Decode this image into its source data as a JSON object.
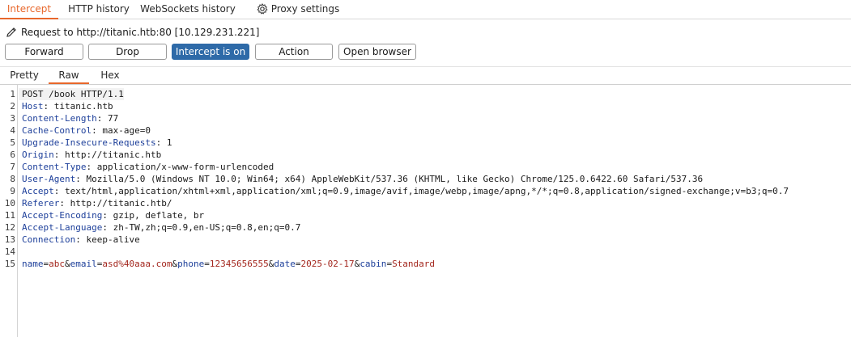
{
  "top_tabs": {
    "intercept": "Intercept",
    "http_history": "HTTP history",
    "websockets_history": "WebSockets history",
    "proxy_settings": "Proxy settings"
  },
  "request_info": "Request to http://titanic.htb:80  [10.129.231.221]",
  "buttons": {
    "forward": "Forward",
    "drop": "Drop",
    "intercept": "Intercept is on",
    "action": "Action",
    "open_browser": "Open browser"
  },
  "view_tabs": {
    "pretty": "Pretty",
    "raw": "Raw",
    "hex": "Hex"
  },
  "line_numbers": [
    "1",
    "2",
    "3",
    "4",
    "5",
    "6",
    "7",
    "8",
    "9",
    "10",
    "11",
    "12",
    "13",
    "14",
    "15"
  ],
  "request_line": "POST /book HTTP/1.1",
  "headers": [
    {
      "name": "Host",
      "value": "titanic.htb"
    },
    {
      "name": "Content-Length",
      "value": "77"
    },
    {
      "name": "Cache-Control",
      "value": "max-age=0"
    },
    {
      "name": "Upgrade-Insecure-Requests",
      "value": "1"
    },
    {
      "name": "Origin",
      "value": "http://titanic.htb"
    },
    {
      "name": "Content-Type",
      "value": "application/x-www-form-urlencoded"
    },
    {
      "name": "User-Agent",
      "value": "Mozilla/5.0 (Windows NT 10.0; Win64; x64) AppleWebKit/537.36 (KHTML, like Gecko) Chrome/125.0.6422.60 Safari/537.36"
    },
    {
      "name": "Accept",
      "value": "text/html,application/xhtml+xml,application/xml;q=0.9,image/avif,image/webp,image/apng,*/*;q=0.8,application/signed-exchange;v=b3;q=0.7"
    },
    {
      "name": "Referer",
      "value": "http://titanic.htb/"
    },
    {
      "name": "Accept-Encoding",
      "value": "gzip, deflate, br"
    },
    {
      "name": "Accept-Language",
      "value": "zh-TW,zh;q=0.9,en-US;q=0.8,en;q=0.7"
    },
    {
      "name": "Connection",
      "value": "keep-alive"
    }
  ],
  "body_params": [
    {
      "key": "name",
      "value": "abc"
    },
    {
      "key": "email",
      "value": "asd%40aaa.com"
    },
    {
      "key": "phone",
      "value": "12345656555"
    },
    {
      "key": "date",
      "value": "2025-02-17"
    },
    {
      "key": "cabin",
      "value": "Standard"
    }
  ],
  "colors": {
    "accent": "#e8672b",
    "button_active": "#2e6aa8",
    "header_name": "#1d3f9a",
    "param_value": "#a3261d"
  },
  "icons": {
    "settings": "gear-icon",
    "edit": "pencil-icon"
  }
}
